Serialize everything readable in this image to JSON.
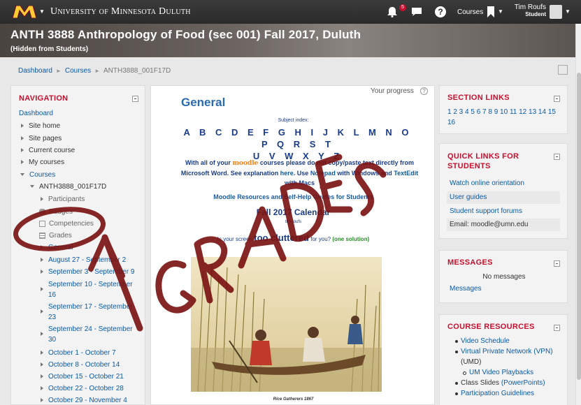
{
  "topbar": {
    "university": "University of Minnesota Duluth",
    "notification_count": "5",
    "courses_label": "Courses",
    "user_name": "Tim Roufs",
    "user_role": "Student"
  },
  "header": {
    "course_title": "ANTH 3888 Anthropology of Food (sec 001) Fall 2017, Duluth",
    "hidden_note": "(Hidden from Students)"
  },
  "breadcrumb": [
    "Dashboard",
    "Courses",
    "ANTH3888_001F17D"
  ],
  "navigation": {
    "heading": "NAVIGATION",
    "items": [
      {
        "label": "Dashboard",
        "link": true
      },
      {
        "label": "Site home",
        "link": false
      },
      {
        "label": "Site pages",
        "link": false
      },
      {
        "label": "Current course",
        "link": false
      },
      {
        "label": "My courses",
        "link": false
      },
      {
        "label": "Courses",
        "link": true
      },
      {
        "label": "ANTH3888_001F17D",
        "link": false
      },
      {
        "label": "Participants",
        "link": false
      },
      {
        "label": "Badges",
        "link": false
      },
      {
        "label": "Competencies",
        "link": false
      },
      {
        "label": "Grades",
        "link": false
      },
      {
        "label": "General",
        "link": true
      },
      {
        "label": "August 27 - September 2",
        "link": true
      },
      {
        "label": "September 3 - September 9",
        "link": true
      },
      {
        "label": "September 10 - September",
        "link": true
      },
      {
        "label": "16",
        "link": true
      },
      {
        "label": "September 17 - September",
        "link": true
      },
      {
        "label": "23",
        "link": true
      },
      {
        "label": "September 24 - September",
        "link": true
      },
      {
        "label": "30",
        "link": true
      },
      {
        "label": "October 1 - October 7",
        "link": true
      },
      {
        "label": "October 8 - October 14",
        "link": true
      },
      {
        "label": "October 15 - October 21",
        "link": true
      },
      {
        "label": "October 22 - October 28",
        "link": true
      },
      {
        "label": "October 29 - November 4",
        "link": true
      }
    ]
  },
  "main": {
    "progress_label": "Your progress",
    "section_title": "General",
    "subject_index_label": "Subject index:",
    "alphabet_row1": "A B C D E F G H I J K L M N O P Q R S T",
    "alphabet_row2": "U V W X Y Z",
    "note_part1": "With all of your",
    "note_moodle": "moodle",
    "note_part2": "courses please do not copy/paste text directly from Microsoft Word. See explanation",
    "note_here": "here",
    "note_part3": ". Use",
    "note_notepad": "Notepad",
    "note_part4": "with Windows and",
    "note_textedit": "TextEdit",
    "note_part5": "with Macs",
    "resources_link": "Moodle Resources and Self-Help Guides for Students",
    "calendar_title": "Fall 2017 Calendar",
    "calendar_sub": "tim roufs",
    "clustered_pre": "Is your",
    "clustered_mid": "screen",
    "clustered_big": "too cluttered",
    "clustered_post": "for you?",
    "clustered_solution": "(one solution)",
    "painting_caption": "Rice Gatherers 1867"
  },
  "section_links": {
    "heading": "SECTION LINKS",
    "numbers": "1 2 3 4 5 6 7 8 9 10 11 12 13 14 15",
    "numbers_row2": "16"
  },
  "quick_links": {
    "heading": "QUICK LINKS FOR STUDENTS",
    "items": [
      "Watch online orientation",
      "User guides",
      "Student support forums"
    ],
    "email_label": "Email:",
    "email_value": "moodle@umn.edu"
  },
  "messages": {
    "heading": "MESSAGES",
    "empty_text": "No messages",
    "link": "Messages"
  },
  "course_resources": {
    "heading": "COURSE RESOURCES",
    "items": [
      {
        "label": "Video Schedule",
        "sub": false
      },
      {
        "label": "Virtual Private Network (VPN)",
        "sub": false
      },
      {
        "label": "(UMD)",
        "sub": false
      },
      {
        "label": "UM Video Playbacks",
        "sub": true
      },
      {
        "label": "Class Slides",
        "sub": false
      },
      {
        "label": "Participation Guidelines",
        "sub": false
      }
    ],
    "slides_suffix": "(PowerPoints)"
  },
  "overlay": {
    "annotation_text": "GRADES",
    "color": "#7a1010"
  },
  "colors": {
    "accent": "#c8102e",
    "link": "#0b5aa6",
    "gold": "#ffcc33",
    "maroon": "#7a0019"
  }
}
